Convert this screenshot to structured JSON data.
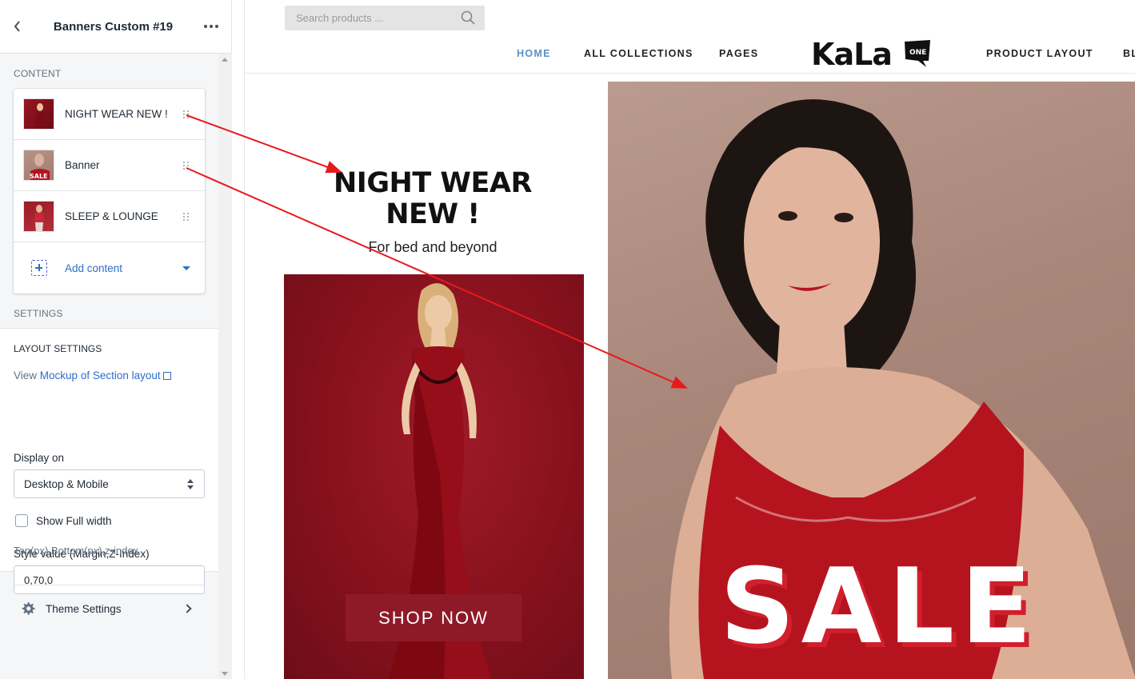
{
  "sidebar": {
    "header": {
      "title": "Banners Custom #19"
    },
    "content_label": "CONTENT",
    "blocks": [
      {
        "label": "NIGHT WEAR NEW !"
      },
      {
        "label": "Banner"
      },
      {
        "label": "SLEEP & LOUNGE"
      }
    ],
    "add_content_label": "Add content",
    "settings_label": "SETTINGS",
    "layout": {
      "heading": "LAYOUT SETTINGS",
      "view_prefix": "View",
      "view_link": "Mockup of Section layout",
      "display_label": "Display on",
      "display_value": "Desktop & Mobile",
      "full_width_label": "Show Full width",
      "full_width_checked": false,
      "style_label": "Style value (Margin,Z-Index)",
      "style_value": "0,70,0",
      "style_help": "Top(px),Bottom(px),z-index"
    },
    "theme_settings_label": "Theme Settings"
  },
  "preview": {
    "search_placeholder": "Search products ...",
    "nav": [
      "HOME",
      "ALL COLLECTIONS",
      "PAGES",
      "PRODUCT LAYOUT",
      "BL"
    ],
    "active_nav": "HOME",
    "logo_text": "KaLa",
    "hero": {
      "title_line1": "NIGHT WEAR",
      "title_line2": "NEW !",
      "subtitle": "For bed and beyond",
      "button": "SHOP NOW"
    },
    "banner_overlay": "SALE"
  },
  "colors": {
    "accent": "#2c6ecb",
    "nav_active": "#5e8fc5",
    "banner_red": "#86111d",
    "button_red": "#8e1a28",
    "sale_shadow": "#d21f2d",
    "arrow": "#e8191d"
  },
  "icons": [
    "back-arrow-icon",
    "more-dots-icon",
    "drag-handle-icon",
    "add-block-icon",
    "caret-down-icon",
    "external-link-icon",
    "select-arrows-icon",
    "gear-icon",
    "chevron-right-icon",
    "search-icon"
  ]
}
